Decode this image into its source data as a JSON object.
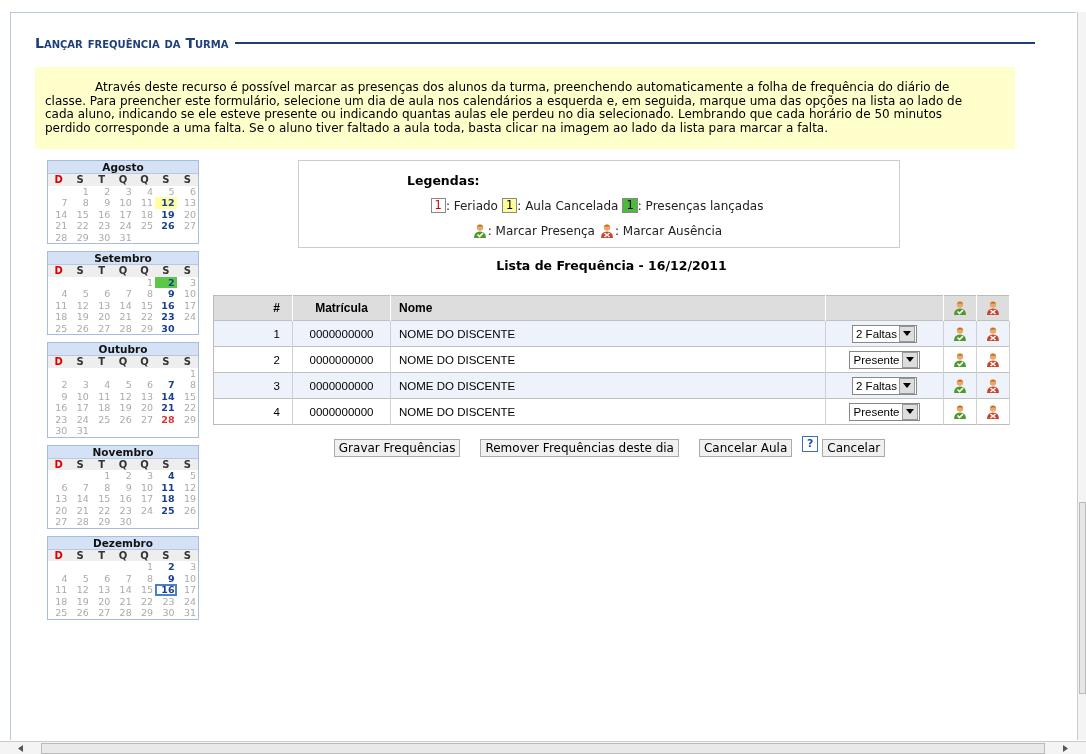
{
  "title": "Lançar frequência da Turma",
  "intro": "Através deste recurso é possível marcar as presenças dos alunos da turma, preenchendo automaticamente a folha de frequência do diário de classe. Para preencher este formulário, selecione um dia de aula nos calendários a esquerda e, em seguida, marque uma das opções na lista ao lado de cada aluno, indicando se ele esteve presente ou indicando quantas aulas ele perdeu no dia selecionado. Lembrando que cada horário de 50 minutos perdido corresponde a uma falta. Se o aluno tiver faltado a aula toda, basta clicar na imagem ao lado da lista para marcar a falta.",
  "months": [
    {
      "name": "Agosto",
      "weekdays": [
        {
          "label": "D",
          "sunday": true
        },
        {
          "label": "S",
          "sunday": false
        },
        {
          "label": "T",
          "sunday": false
        },
        {
          "label": "Q",
          "sunday": false
        },
        {
          "label": "Q",
          "sunday": false
        },
        {
          "label": "S",
          "sunday": false
        },
        {
          "label": "S",
          "sunday": false
        }
      ],
      "weeks": [
        [
          {
            "d": "1",
            "kind": "plain"
          },
          {
            "d": "2",
            "kind": "plain"
          },
          {
            "d": "3",
            "kind": "plain"
          },
          {
            "d": "4",
            "kind": "plain"
          },
          {
            "d": "5",
            "kind": "plain"
          },
          {
            "d": "6",
            "kind": "plain"
          }
        ],
        [
          {
            "d": "7",
            "kind": "plain"
          },
          {
            "d": "8",
            "kind": "plain"
          },
          {
            "d": "9",
            "kind": "plain"
          },
          {
            "d": "10",
            "kind": "plain"
          },
          {
            "d": "11",
            "kind": "plain"
          },
          {
            "d": "12",
            "kind": "cancelled"
          },
          {
            "d": "13",
            "kind": "plain"
          }
        ],
        [
          {
            "d": "14",
            "kind": "plain"
          },
          {
            "d": "15",
            "kind": "plain"
          },
          {
            "d": "16",
            "kind": "plain"
          },
          {
            "d": "17",
            "kind": "plain"
          },
          {
            "d": "18",
            "kind": "plain"
          },
          {
            "d": "19",
            "kind": "class"
          },
          {
            "d": "20",
            "kind": "plain"
          }
        ],
        [
          {
            "d": "21",
            "kind": "plain"
          },
          {
            "d": "22",
            "kind": "plain"
          },
          {
            "d": "23",
            "kind": "plain"
          },
          {
            "d": "24",
            "kind": "plain"
          },
          {
            "d": "25",
            "kind": "plain"
          },
          {
            "d": "26",
            "kind": "class"
          },
          {
            "d": "27",
            "kind": "plain"
          }
        ],
        [
          {
            "d": "28",
            "kind": "plain"
          },
          {
            "d": "29",
            "kind": "plain"
          },
          {
            "d": "30",
            "kind": "plain"
          },
          {
            "d": "31",
            "kind": "plain"
          }
        ]
      ]
    },
    {
      "name": "Setembro",
      "weekdays": [
        {
          "label": "D",
          "sunday": true
        },
        {
          "label": "S",
          "sunday": false
        },
        {
          "label": "T",
          "sunday": false
        },
        {
          "label": "Q",
          "sunday": false
        },
        {
          "label": "Q",
          "sunday": false
        },
        {
          "label": "S",
          "sunday": false
        },
        {
          "label": "S",
          "sunday": false
        }
      ],
      "weeks": [
        [
          {
            "d": "1",
            "kind": "plain"
          },
          {
            "d": "2",
            "kind": "presence"
          },
          {
            "d": "3",
            "kind": "plain"
          }
        ],
        [
          {
            "d": "4",
            "kind": "plain"
          },
          {
            "d": "5",
            "kind": "plain"
          },
          {
            "d": "6",
            "kind": "plain"
          },
          {
            "d": "7",
            "kind": "plain"
          },
          {
            "d": "8",
            "kind": "plain"
          },
          {
            "d": "9",
            "kind": "class"
          },
          {
            "d": "10",
            "kind": "plain"
          }
        ],
        [
          {
            "d": "11",
            "kind": "plain"
          },
          {
            "d": "12",
            "kind": "plain"
          },
          {
            "d": "13",
            "kind": "plain"
          },
          {
            "d": "14",
            "kind": "plain"
          },
          {
            "d": "15",
            "kind": "plain"
          },
          {
            "d": "16",
            "kind": "class"
          },
          {
            "d": "17",
            "kind": "plain"
          }
        ],
        [
          {
            "d": "18",
            "kind": "plain"
          },
          {
            "d": "19",
            "kind": "plain"
          },
          {
            "d": "20",
            "kind": "plain"
          },
          {
            "d": "21",
            "kind": "plain"
          },
          {
            "d": "22",
            "kind": "plain"
          },
          {
            "d": "23",
            "kind": "class"
          },
          {
            "d": "24",
            "kind": "plain"
          }
        ],
        [
          {
            "d": "25",
            "kind": "plain"
          },
          {
            "d": "26",
            "kind": "plain"
          },
          {
            "d": "27",
            "kind": "plain"
          },
          {
            "d": "28",
            "kind": "plain"
          },
          {
            "d": "29",
            "kind": "plain"
          },
          {
            "d": "30",
            "kind": "class"
          }
        ]
      ]
    },
    {
      "name": "Outubro",
      "weekdays": [
        {
          "label": "D",
          "sunday": true
        },
        {
          "label": "S",
          "sunday": false
        },
        {
          "label": "T",
          "sunday": false
        },
        {
          "label": "Q",
          "sunday": false
        },
        {
          "label": "Q",
          "sunday": false
        },
        {
          "label": "S",
          "sunday": false
        },
        {
          "label": "S",
          "sunday": false
        }
      ],
      "weeks": [
        [
          {
            "d": "1",
            "kind": "plain"
          }
        ],
        [
          {
            "d": "2",
            "kind": "plain"
          },
          {
            "d": "3",
            "kind": "plain"
          },
          {
            "d": "4",
            "kind": "plain"
          },
          {
            "d": "5",
            "kind": "plain"
          },
          {
            "d": "6",
            "kind": "plain"
          },
          {
            "d": "7",
            "kind": "class"
          },
          {
            "d": "8",
            "kind": "plain"
          }
        ],
        [
          {
            "d": "9",
            "kind": "plain"
          },
          {
            "d": "10",
            "kind": "plain"
          },
          {
            "d": "11",
            "kind": "plain"
          },
          {
            "d": "12",
            "kind": "plain"
          },
          {
            "d": "13",
            "kind": "plain"
          },
          {
            "d": "14",
            "kind": "class"
          },
          {
            "d": "15",
            "kind": "plain"
          }
        ],
        [
          {
            "d": "16",
            "kind": "plain"
          },
          {
            "d": "17",
            "kind": "plain"
          },
          {
            "d": "18",
            "kind": "plain"
          },
          {
            "d": "19",
            "kind": "plain"
          },
          {
            "d": "20",
            "kind": "plain"
          },
          {
            "d": "21",
            "kind": "class"
          },
          {
            "d": "22",
            "kind": "plain"
          }
        ],
        [
          {
            "d": "23",
            "kind": "plain"
          },
          {
            "d": "24",
            "kind": "plain"
          },
          {
            "d": "25",
            "kind": "plain"
          },
          {
            "d": "26",
            "kind": "plain"
          },
          {
            "d": "27",
            "kind": "plain"
          },
          {
            "d": "28",
            "kind": "holiday"
          },
          {
            "d": "29",
            "kind": "plain"
          }
        ],
        [
          {
            "d": "30",
            "kind": "plain"
          },
          {
            "d": "31",
            "kind": "plain"
          }
        ]
      ]
    },
    {
      "name": "Novembro",
      "weekdays": [
        {
          "label": "D",
          "sunday": true
        },
        {
          "label": "S",
          "sunday": false
        },
        {
          "label": "T",
          "sunday": false
        },
        {
          "label": "Q",
          "sunday": false
        },
        {
          "label": "Q",
          "sunday": false
        },
        {
          "label": "S",
          "sunday": false
        },
        {
          "label": "S",
          "sunday": false
        }
      ],
      "weeks": [
        [
          {
            "d": "1",
            "kind": "plain"
          },
          {
            "d": "2",
            "kind": "plain"
          },
          {
            "d": "3",
            "kind": "plain"
          },
          {
            "d": "4",
            "kind": "class"
          },
          {
            "d": "5",
            "kind": "plain"
          }
        ],
        [
          {
            "d": "6",
            "kind": "plain"
          },
          {
            "d": "7",
            "kind": "plain"
          },
          {
            "d": "8",
            "kind": "plain"
          },
          {
            "d": "9",
            "kind": "plain"
          },
          {
            "d": "10",
            "kind": "plain"
          },
          {
            "d": "11",
            "kind": "class"
          },
          {
            "d": "12",
            "kind": "plain"
          }
        ],
        [
          {
            "d": "13",
            "kind": "plain"
          },
          {
            "d": "14",
            "kind": "plain"
          },
          {
            "d": "15",
            "kind": "plain"
          },
          {
            "d": "16",
            "kind": "plain"
          },
          {
            "d": "17",
            "kind": "plain"
          },
          {
            "d": "18",
            "kind": "class"
          },
          {
            "d": "19",
            "kind": "plain"
          }
        ],
        [
          {
            "d": "20",
            "kind": "plain"
          },
          {
            "d": "21",
            "kind": "plain"
          },
          {
            "d": "22",
            "kind": "plain"
          },
          {
            "d": "23",
            "kind": "plain"
          },
          {
            "d": "24",
            "kind": "plain"
          },
          {
            "d": "25",
            "kind": "class"
          },
          {
            "d": "26",
            "kind": "plain"
          }
        ],
        [
          {
            "d": "27",
            "kind": "plain"
          },
          {
            "d": "28",
            "kind": "plain"
          },
          {
            "d": "29",
            "kind": "plain"
          },
          {
            "d": "30",
            "kind": "plain"
          }
        ]
      ]
    },
    {
      "name": "Dezembro",
      "weekdays": [
        {
          "label": "D",
          "sunday": true
        },
        {
          "label": "S",
          "sunday": false
        },
        {
          "label": "T",
          "sunday": false
        },
        {
          "label": "Q",
          "sunday": false
        },
        {
          "label": "Q",
          "sunday": false
        },
        {
          "label": "S",
          "sunday": false
        },
        {
          "label": "S",
          "sunday": false
        }
      ],
      "weeks": [
        [
          {
            "d": "1",
            "kind": "plain"
          },
          {
            "d": "2",
            "kind": "class"
          },
          {
            "d": "3",
            "kind": "plain"
          }
        ],
        [
          {
            "d": "4",
            "kind": "plain"
          },
          {
            "d": "5",
            "kind": "plain"
          },
          {
            "d": "6",
            "kind": "plain"
          },
          {
            "d": "7",
            "kind": "plain"
          },
          {
            "d": "8",
            "kind": "plain"
          },
          {
            "d": "9",
            "kind": "class"
          },
          {
            "d": "10",
            "kind": "plain"
          }
        ],
        [
          {
            "d": "11",
            "kind": "plain"
          },
          {
            "d": "12",
            "kind": "plain"
          },
          {
            "d": "13",
            "kind": "plain"
          },
          {
            "d": "14",
            "kind": "plain"
          },
          {
            "d": "15",
            "kind": "plain"
          },
          {
            "d": "16",
            "kind": "selected"
          },
          {
            "d": "17",
            "kind": "plain"
          }
        ],
        [
          {
            "d": "18",
            "kind": "plain"
          },
          {
            "d": "19",
            "kind": "plain"
          },
          {
            "d": "20",
            "kind": "plain"
          },
          {
            "d": "21",
            "kind": "plain"
          },
          {
            "d": "22",
            "kind": "plain"
          },
          {
            "d": "23",
            "kind": "plain"
          },
          {
            "d": "24",
            "kind": "plain"
          }
        ],
        [
          {
            "d": "25",
            "kind": "plain"
          },
          {
            "d": "26",
            "kind": "plain"
          },
          {
            "d": "27",
            "kind": "plain"
          },
          {
            "d": "28",
            "kind": "plain"
          },
          {
            "d": "29",
            "kind": "plain"
          },
          {
            "d": "30",
            "kind": "plain"
          },
          {
            "d": "31",
            "kind": "plain"
          }
        ]
      ]
    }
  ],
  "legend": {
    "title": "Legendas:",
    "swatches": [
      {
        "sample": "1",
        "kind": "holiday",
        "label": ": Feriado"
      },
      {
        "sample": "1",
        "kind": "cancelled",
        "label": ": Aula Cancelada"
      },
      {
        "sample": "1",
        "kind": "presence",
        "label": ": Presenças lançadas"
      }
    ],
    "icons": [
      {
        "kind": "present",
        "label": ": Marcar Presença"
      },
      {
        "kind": "absent",
        "label": ": Marcar Ausência"
      }
    ]
  },
  "list_title": "Lista de Frequência - 16/12/2011",
  "table": {
    "columns": [
      "#",
      "Matrícula",
      "Nome"
    ],
    "rows": [
      {
        "num": "1",
        "matricula": "0000000000",
        "nome": "NOME DO DISCENTE",
        "option": "2 Faltas"
      },
      {
        "num": "2",
        "matricula": "0000000000",
        "nome": "NOME DO DISCENTE",
        "option": "Presente"
      },
      {
        "num": "3",
        "matricula": "0000000000",
        "nome": "NOME DO DISCENTE",
        "option": "2 Faltas"
      },
      {
        "num": "4",
        "matricula": "0000000000",
        "nome": "NOME DO DISCENTE",
        "option": "Presente"
      }
    ]
  },
  "buttons": [
    {
      "label": "Gravar Frequências",
      "kind": "button"
    },
    {
      "label": "Remover Frequências deste dia",
      "kind": "button"
    },
    {
      "label": "Cancelar Aula",
      "kind": "button"
    },
    {
      "label": "?",
      "kind": "help"
    },
    {
      "label": "Cancelar",
      "kind": "button"
    }
  ]
}
